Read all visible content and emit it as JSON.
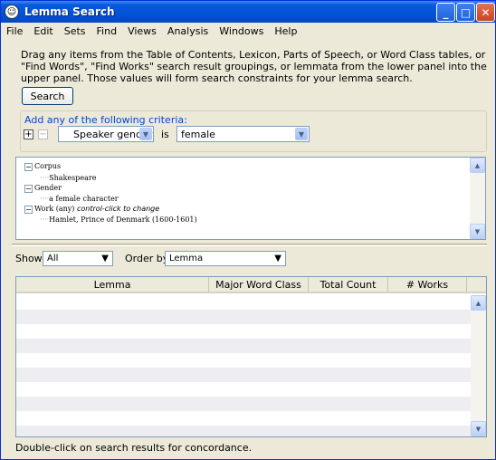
{
  "window": {
    "title": "Lemma Search"
  },
  "menu": [
    "File",
    "Edit",
    "Sets",
    "Find",
    "Views",
    "Analysis",
    "Windows",
    "Help"
  ],
  "instructions": "Drag any items from the Table of Contents, Lexicon, Parts of Speech, or Word Class tables, or  \"Find Words\", \"Find Works\" search result groupings,  or lemmata from the lower panel into the upper panel.  Those values will form search constraints for your lemma search.",
  "search_button": "Search",
  "criteria": {
    "legend": "Add any of the following criteria:",
    "field": "Speaker gender",
    "operator": "is",
    "value": "female"
  },
  "tree": {
    "corpus_label": "Corpus",
    "corpus_value": "Shakespeare",
    "gender_label": "Gender",
    "gender_value": "a female character",
    "work_label": "Work (any)",
    "work_hint": "control-click to change",
    "work_value": "Hamlet, Prince of Denmark (1600-1601)"
  },
  "controls": {
    "show_label": "Show:",
    "show_value": "All",
    "order_label": "Order by:",
    "order_value": "Lemma"
  },
  "table": {
    "columns": [
      "Lemma",
      "Major Word Class",
      "Total Count",
      "# Works"
    ]
  },
  "status": "Double-click on search results for concordance."
}
